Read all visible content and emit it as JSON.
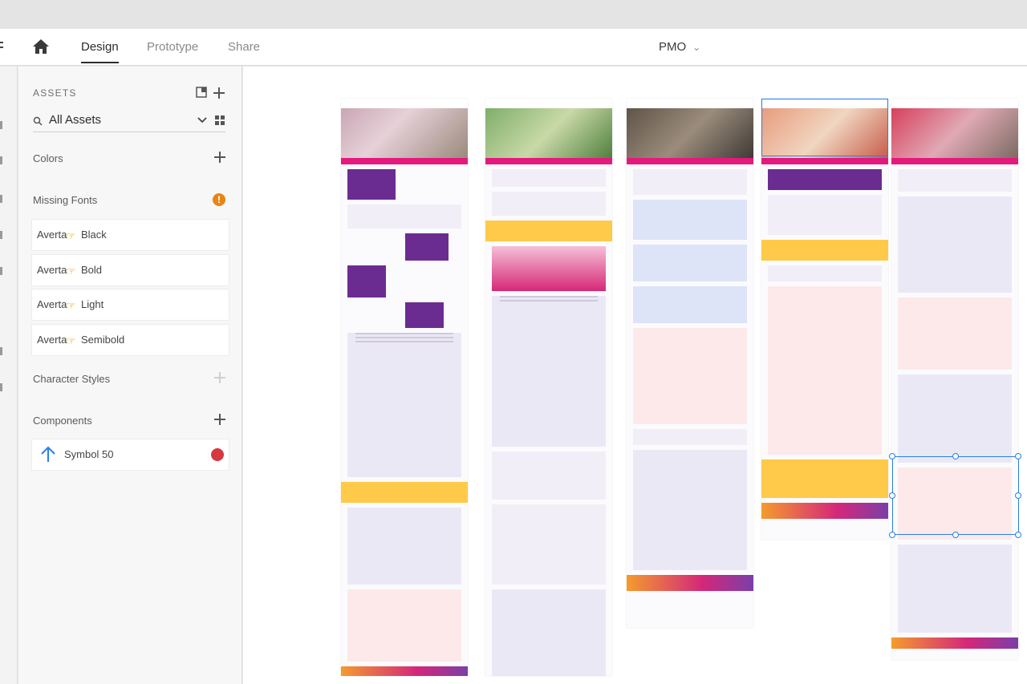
{
  "topbar": {
    "tabs": [
      {
        "label": "Design",
        "active": true
      },
      {
        "label": "Prototype",
        "active": false
      },
      {
        "label": "Share",
        "active": false
      }
    ],
    "document_title": "PMO"
  },
  "assets": {
    "title": "ASSETS",
    "filter_label": "All Assets",
    "colors_label": "Colors",
    "missing_fonts_label": "Missing Fonts",
    "missing_fonts_badge": "!",
    "fonts": [
      {
        "family": "Averta",
        "style": "Black"
      },
      {
        "family": "Averta",
        "style": "Bold"
      },
      {
        "family": "Averta",
        "style": "Light"
      },
      {
        "family": "Averta",
        "style": "Semibold"
      }
    ],
    "character_styles_label": "Character Styles",
    "components_label": "Components",
    "components": [
      {
        "label": "Symbol 50"
      }
    ]
  },
  "colors": {
    "brand_pink": "#e5197d",
    "brand_purple": "#6b2c91",
    "brand_yellow": "#ffc94a",
    "selection_blue": "#2680eb",
    "warning_orange": "#e68619"
  }
}
